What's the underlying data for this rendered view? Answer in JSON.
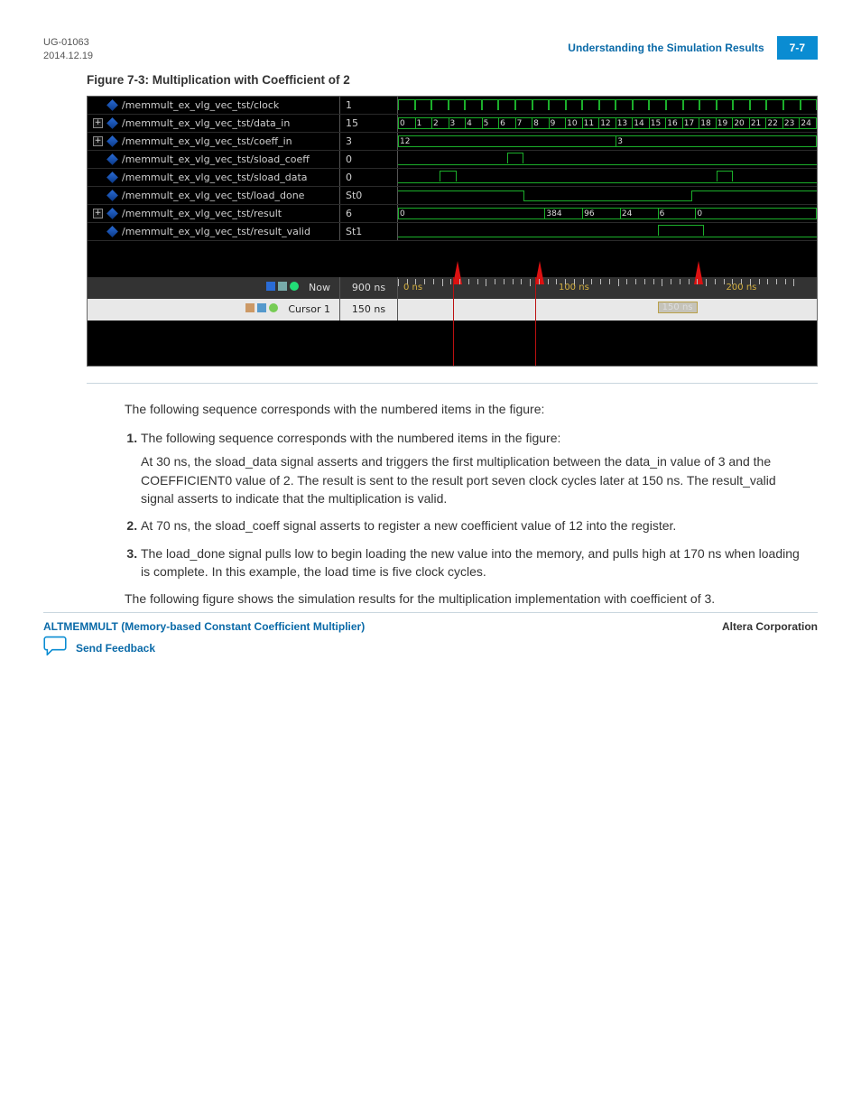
{
  "header": {
    "doc_id": "UG-01063",
    "date": "2014.12.19",
    "section_title": "Understanding the Simulation Results",
    "page_label": "7-7"
  },
  "figure": {
    "caption": "Figure 7-3: Multiplication with Coefficient of 2",
    "signals": [
      {
        "name": "/memmult_ex_vlg_vec_tst/clock",
        "value": "1",
        "expandable": false,
        "type": "clock"
      },
      {
        "name": "/memmult_ex_vlg_vec_tst/data_in",
        "value": "15",
        "expandable": true,
        "type": "bus_count"
      },
      {
        "name": "/memmult_ex_vlg_vec_tst/coeff_in",
        "value": "3",
        "expandable": true,
        "type": "bus_coeff"
      },
      {
        "name": "/memmult_ex_vlg_vec_tst/sload_coeff",
        "value": "0",
        "expandable": false,
        "type": "pulse1"
      },
      {
        "name": "/memmult_ex_vlg_vec_tst/sload_data",
        "value": "0",
        "expandable": false,
        "type": "pulse2"
      },
      {
        "name": "/memmult_ex_vlg_vec_tst/load_done",
        "value": "St0",
        "expandable": false,
        "type": "loaddone"
      },
      {
        "name": "/memmult_ex_vlg_vec_tst/result",
        "value": "6",
        "expandable": true,
        "type": "bus_result"
      },
      {
        "name": "/memmult_ex_vlg_vec_tst/result_valid",
        "value": "St1",
        "expandable": false,
        "type": "validpulse"
      }
    ],
    "data_in_cells": [
      "0",
      "1",
      "2",
      "3",
      "4",
      "5",
      "6",
      "7",
      "8",
      "9",
      "10",
      "11",
      "12",
      "13",
      "14",
      "15",
      "16",
      "17",
      "18",
      "19",
      "20",
      "21",
      "22",
      "23",
      "24"
    ],
    "coeff_in_cells": {
      "first": "12",
      "second": "3"
    },
    "result_cells": [
      "0",
      "384",
      "96",
      "24",
      "6",
      "0"
    ],
    "now_row": {
      "label": "Now",
      "value": "900 ns",
      "axis": {
        "left_label": "0 ns",
        "mid_label": "100 ns",
        "right_label": "200 ns"
      }
    },
    "cursor_row": {
      "label": "Cursor 1",
      "value": "150 ns",
      "marker": "150 ns"
    }
  },
  "body": {
    "intro": "The following sequence corresponds with the numbered items in the figure:",
    "items": [
      {
        "lead": "The following sequence corresponds with the numbered items in the figure:",
        "para": "At 30 ns, the sload_data signal asserts and triggers the first multiplication between the data_in value of 3 and the COEFFICIENT0 value of 2. The result is sent to the result port seven clock cycles later at 150 ns. The result_valid signal asserts to indicate that the multiplication is valid."
      },
      {
        "lead": "At 70 ns, the sload_coeff signal asserts to register a new coefficient value of 12 into the register."
      },
      {
        "lead": "The load_done signal pulls low to begin loading the new value into the memory, and pulls high at 170 ns when loading is complete. In this example, the load time is five clock cycles."
      }
    ],
    "outro": "The following figure shows the simulation results for the multiplication implementation with coefficient of 3."
  },
  "footer": {
    "left": "ALTMEMMULT (Memory-based Constant Coefficient Multiplier)",
    "right": "Altera Corporation",
    "feedback": "Send Feedback"
  }
}
